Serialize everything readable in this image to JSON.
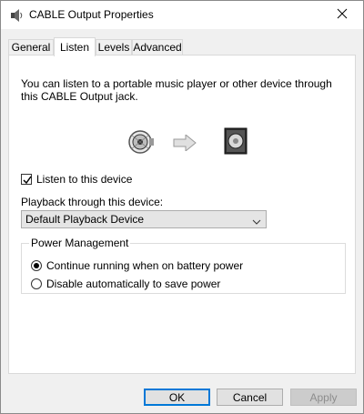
{
  "window": {
    "title": "CABLE Output Properties",
    "icons": {
      "app": "speaker-icon",
      "close": "close-icon"
    }
  },
  "tabs": [
    {
      "label": "General",
      "active": false
    },
    {
      "label": "Listen",
      "active": true
    },
    {
      "label": "Levels",
      "active": false
    },
    {
      "label": "Advanced",
      "active": false
    }
  ],
  "listen": {
    "description": "You can listen to a portable music player or other device through this CABLE Output jack.",
    "graphic": {
      "source_icon": "audio-source-icon",
      "arrow_icon": "arrow-right-icon",
      "target_icon": "speaker-device-icon"
    },
    "listen_checkbox": {
      "label": "Listen to this device",
      "checked": true
    },
    "playback_label": "Playback through this device:",
    "playback_select": {
      "value": "Default Playback Device"
    }
  },
  "power_management": {
    "legend": "Power Management",
    "options": [
      {
        "label": "Continue running when on battery power",
        "checked": true
      },
      {
        "label": "Disable automatically to save power",
        "checked": false
      }
    ]
  },
  "buttons": {
    "ok": "OK",
    "cancel": "Cancel",
    "apply": "Apply"
  },
  "colors": {
    "accent": "#0078d7",
    "panel": "#ffffff",
    "chrome": "#f0f0f0"
  }
}
